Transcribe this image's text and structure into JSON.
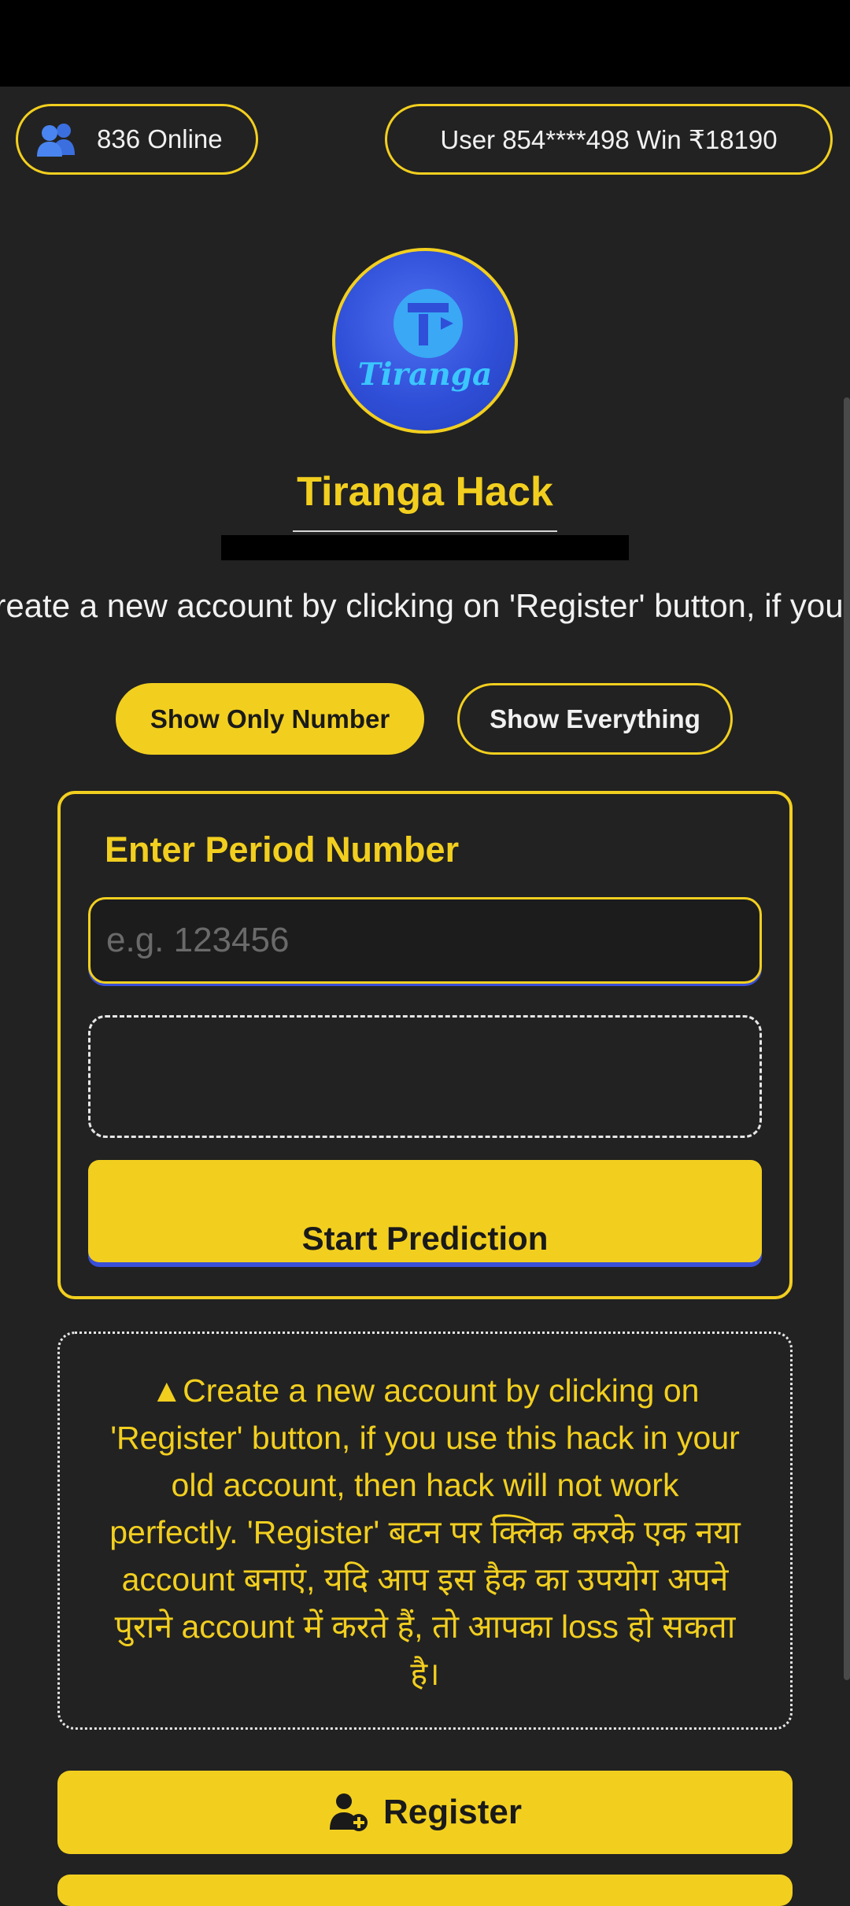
{
  "stats": {
    "online_text": "836 Online",
    "winner_text": "User 854****498 Win ₹18190"
  },
  "app": {
    "logo_text": "Tiranga",
    "title": "Tiranga Hack"
  },
  "marquee_text": "Create a new account by clicking on 'Register' button, if you use this hack in your old account, then hack will not work perfectly.",
  "mode_toggle": {
    "show_only_number": "Show Only Number",
    "show_everything": "Show Everything",
    "selected": "Show Only Number"
  },
  "prediction_form": {
    "label": "Enter Period Number",
    "input_value": "",
    "input_placeholder": "e.g. 123456",
    "result_text": "",
    "submit_label": "Start Prediction"
  },
  "notice": {
    "icon": "▲",
    "text": "Create a new account by clicking on 'Register' button, if you use this hack in your old account, then hack will not work perfectly. 'Register' बटन पर क्लिक करके एक नया account बनाएं, यदि आप इस हैक का उपयोग अपने पुराने account में करते हैं, तो आपका loss हो सकता है।"
  },
  "register_button": {
    "label": "Register",
    "icon": "add-user-icon"
  },
  "colors": {
    "accent": "#f2cf1f",
    "background": "#222222",
    "text": "#f1f1f1"
  }
}
